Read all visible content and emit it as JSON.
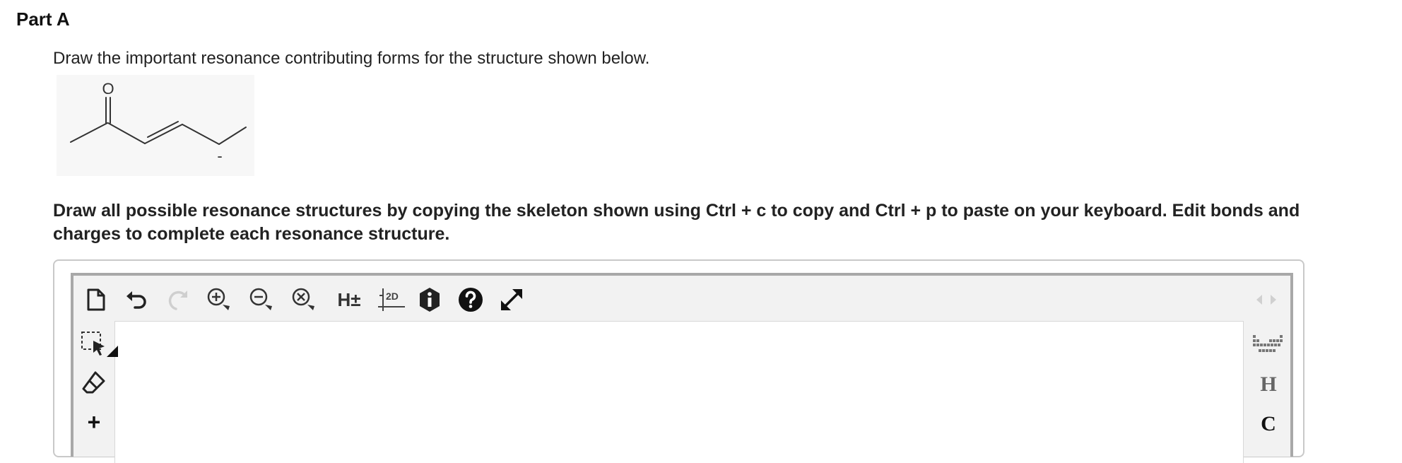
{
  "part": {
    "title": "Part A"
  },
  "question": {
    "prompt": "Draw the important resonance contributing forms for the structure shown below.",
    "molecule": {
      "oxygen_label": "O",
      "charge_label": "-"
    },
    "instruction": "Draw all possible resonance structures by copying the skeleton shown using Ctrl + c to copy and Ctrl + p to paste on your keyboard. Edit bonds and charges to complete each resonance structure."
  },
  "sketcher": {
    "toolbar": {
      "items": [
        {
          "icon": "new-document-icon"
        },
        {
          "icon": "undo-icon"
        },
        {
          "icon": "redo-icon"
        },
        {
          "icon": "zoom-in-icon"
        },
        {
          "icon": "zoom-out-icon"
        },
        {
          "icon": "zoom-reset-icon"
        },
        {
          "icon": "hydrogen-toggle-icon",
          "label": "H±"
        },
        {
          "icon": "clean-2d-icon",
          "label": "2D"
        },
        {
          "icon": "info-icon"
        },
        {
          "icon": "help-icon"
        },
        {
          "icon": "fullscreen-icon"
        }
      ],
      "nav_icon": "left-right-arrows-icon"
    },
    "left_tools": [
      {
        "icon": "selection-icon"
      },
      {
        "icon": "eraser-icon"
      },
      {
        "icon": "plus-charge-icon",
        "label": "+"
      }
    ],
    "right_tools": [
      {
        "icon": "periodic-table-icon"
      },
      {
        "label": "H"
      },
      {
        "label": "C"
      }
    ]
  }
}
